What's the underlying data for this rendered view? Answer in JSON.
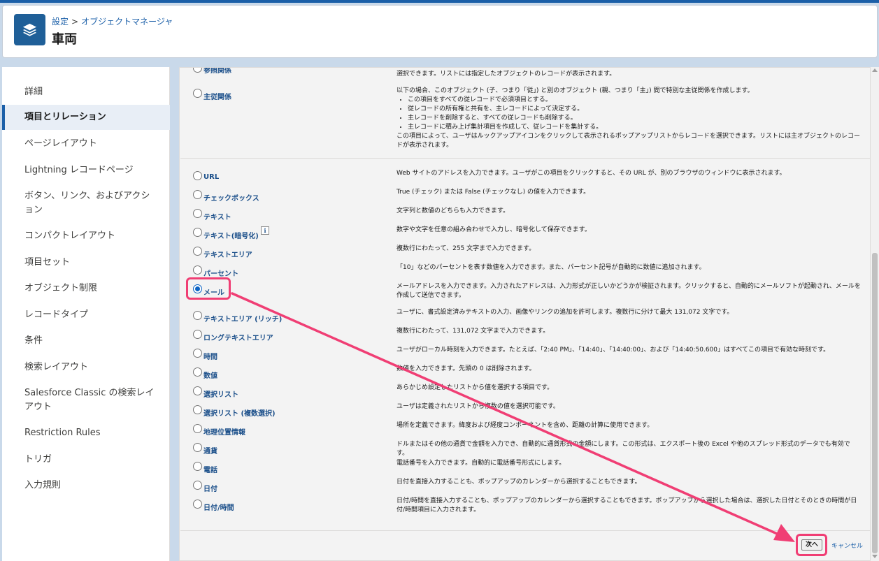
{
  "breadcrumb": {
    "setup": "設定",
    "separator": ">",
    "object_manager": "オブジェクトマネージャ"
  },
  "page_title": "車両",
  "sidebar": {
    "items": [
      {
        "label": "詳細"
      },
      {
        "label": "項目とリレーション",
        "active": true
      },
      {
        "label": "ページレイアウト"
      },
      {
        "label": "Lightning レコードページ"
      },
      {
        "label": "ボタン、リンク、およびアクション"
      },
      {
        "label": "コンパクトレイアウト"
      },
      {
        "label": "項目セット"
      },
      {
        "label": "オブジェクト制限"
      },
      {
        "label": "レコードタイプ"
      },
      {
        "label": "条件"
      },
      {
        "label": "検索レイアウト"
      },
      {
        "label": "Salesforce Classic の検索レイアウト"
      },
      {
        "label": "Restriction Rules"
      },
      {
        "label": "トリガ"
      },
      {
        "label": "入力規則"
      }
    ]
  },
  "relations": {
    "lookup_label": "参照関係",
    "lookup_desc": "選択できます。リストには指定したオブジェクトのレコードが表示されます。",
    "master_label": "主従関係",
    "master_intro": "以下の場合、このオブジェクト (子、つまり「従」) と別のオブジェクト (親、つまり「主」) 間で特別な主従関係を作成します。",
    "master_bullets": [
      "この項目をすべての従レコードで必須項目とする。",
      "従レコードの所有権と共有を、主レコードによって決定する。",
      "主レコードを削除すると、すべての従レコードも削除する。",
      "主レコードに積み上げ集計項目を作成して、従レコードを集計する。"
    ],
    "master_footer": "この項目によって、ユーザはルックアップアイコンをクリックして表示されるポップアップリストからレコードを選択できます。リストには主オブジェクトのレコードが表示されます。"
  },
  "field_types": [
    {
      "label": "URL",
      "desc": "Web サイトのアドレスを入力できます。ユーザがこの項目をクリックすると、その URL が、別のブラウザのウィンドウに表示されます。"
    },
    {
      "label": "チェックボックス",
      "desc": "True (チェック) または False (チェックなし) の値を入力できます。"
    },
    {
      "label": "テキスト",
      "desc": "文字列と数値のどちらも入力できます。"
    },
    {
      "label": "テキスト(暗号化)",
      "desc": "数字や文字を任意の組み合わせで入力し、暗号化して保存できます。",
      "info": "i"
    },
    {
      "label": "テキストエリア",
      "desc": "複数行にわたって、255 文字まで入力できます。"
    },
    {
      "label": "パーセント",
      "desc": "「10」などのパーセントを表す数値を入力できます。また、パーセント記号が自動的に数値に追加されます。"
    },
    {
      "label": "メール",
      "desc": "メールアドレスを入力できます。入力されたアドレスは、入力形式が正しいかどうかが検証されます。クリックすると、自動的にメールソフトが起動され、メールを作成して送信できます。",
      "selected": true
    },
    {
      "label": "テキストエリア (リッチ)",
      "desc": "ユーザに、書式設定済みテキストの入力、画像やリンクの追加を許可します。複数行に分けて最大 131,072 文字です。"
    },
    {
      "label": "ロングテキストエリア",
      "desc": "複数行にわたって、131,072 文字まで入力できます。"
    },
    {
      "label": "時間",
      "desc": "ユーザがローカル時刻を入力できます。たとえば、「2:40 PM」、「14:40」、「14:40:00」、および「14:40:50.600」はすべてこの項目で有効な時刻です。"
    },
    {
      "label": "数値",
      "desc": "数値を入力できます。先頭の 0 は削除されます。"
    },
    {
      "label": "選択リスト",
      "desc": "あらかじめ設定したリストから値を選択する項目です。"
    },
    {
      "label": "選択リスト (複数選択)",
      "desc": "ユーザは定義されたリストから複数の値を選択可能です。"
    },
    {
      "label": "地理位置情報",
      "desc": "場所を定義できます。緯度および経度コンポーネントを含め、距離の計算に使用できます。"
    },
    {
      "label": "通貨",
      "desc": "ドルまたはその他の通貨で金額を入力でき、自動的に通貨形式の金額にします。この形式は、エクスポート後の Excel や他のスプレッド形式のデータでも有効です。"
    },
    {
      "label": "電話",
      "desc": "電話番号を入力できます。自動的に電話番号形式にします。"
    },
    {
      "label": "日付",
      "desc": "日付を直接入力することも、ポップアップのカレンダーから選択することもできます。"
    },
    {
      "label": "日付/時間",
      "desc": "日付/時間を直接入力することも、ポップアップのカレンダーから選択することもできます。ポップアップから選択した場合は、選択した日付とそのときの時間が日付/時間項目に入力されます。"
    }
  ],
  "buttons": {
    "next": "次へ",
    "cancel": "キャンセル"
  },
  "colors": {
    "brand": "#1b5fa8",
    "highlight": "#f03e74",
    "icon_bg": "#1f5f98"
  },
  "icons": {
    "header": "layers-icon",
    "info": "info-icon"
  }
}
